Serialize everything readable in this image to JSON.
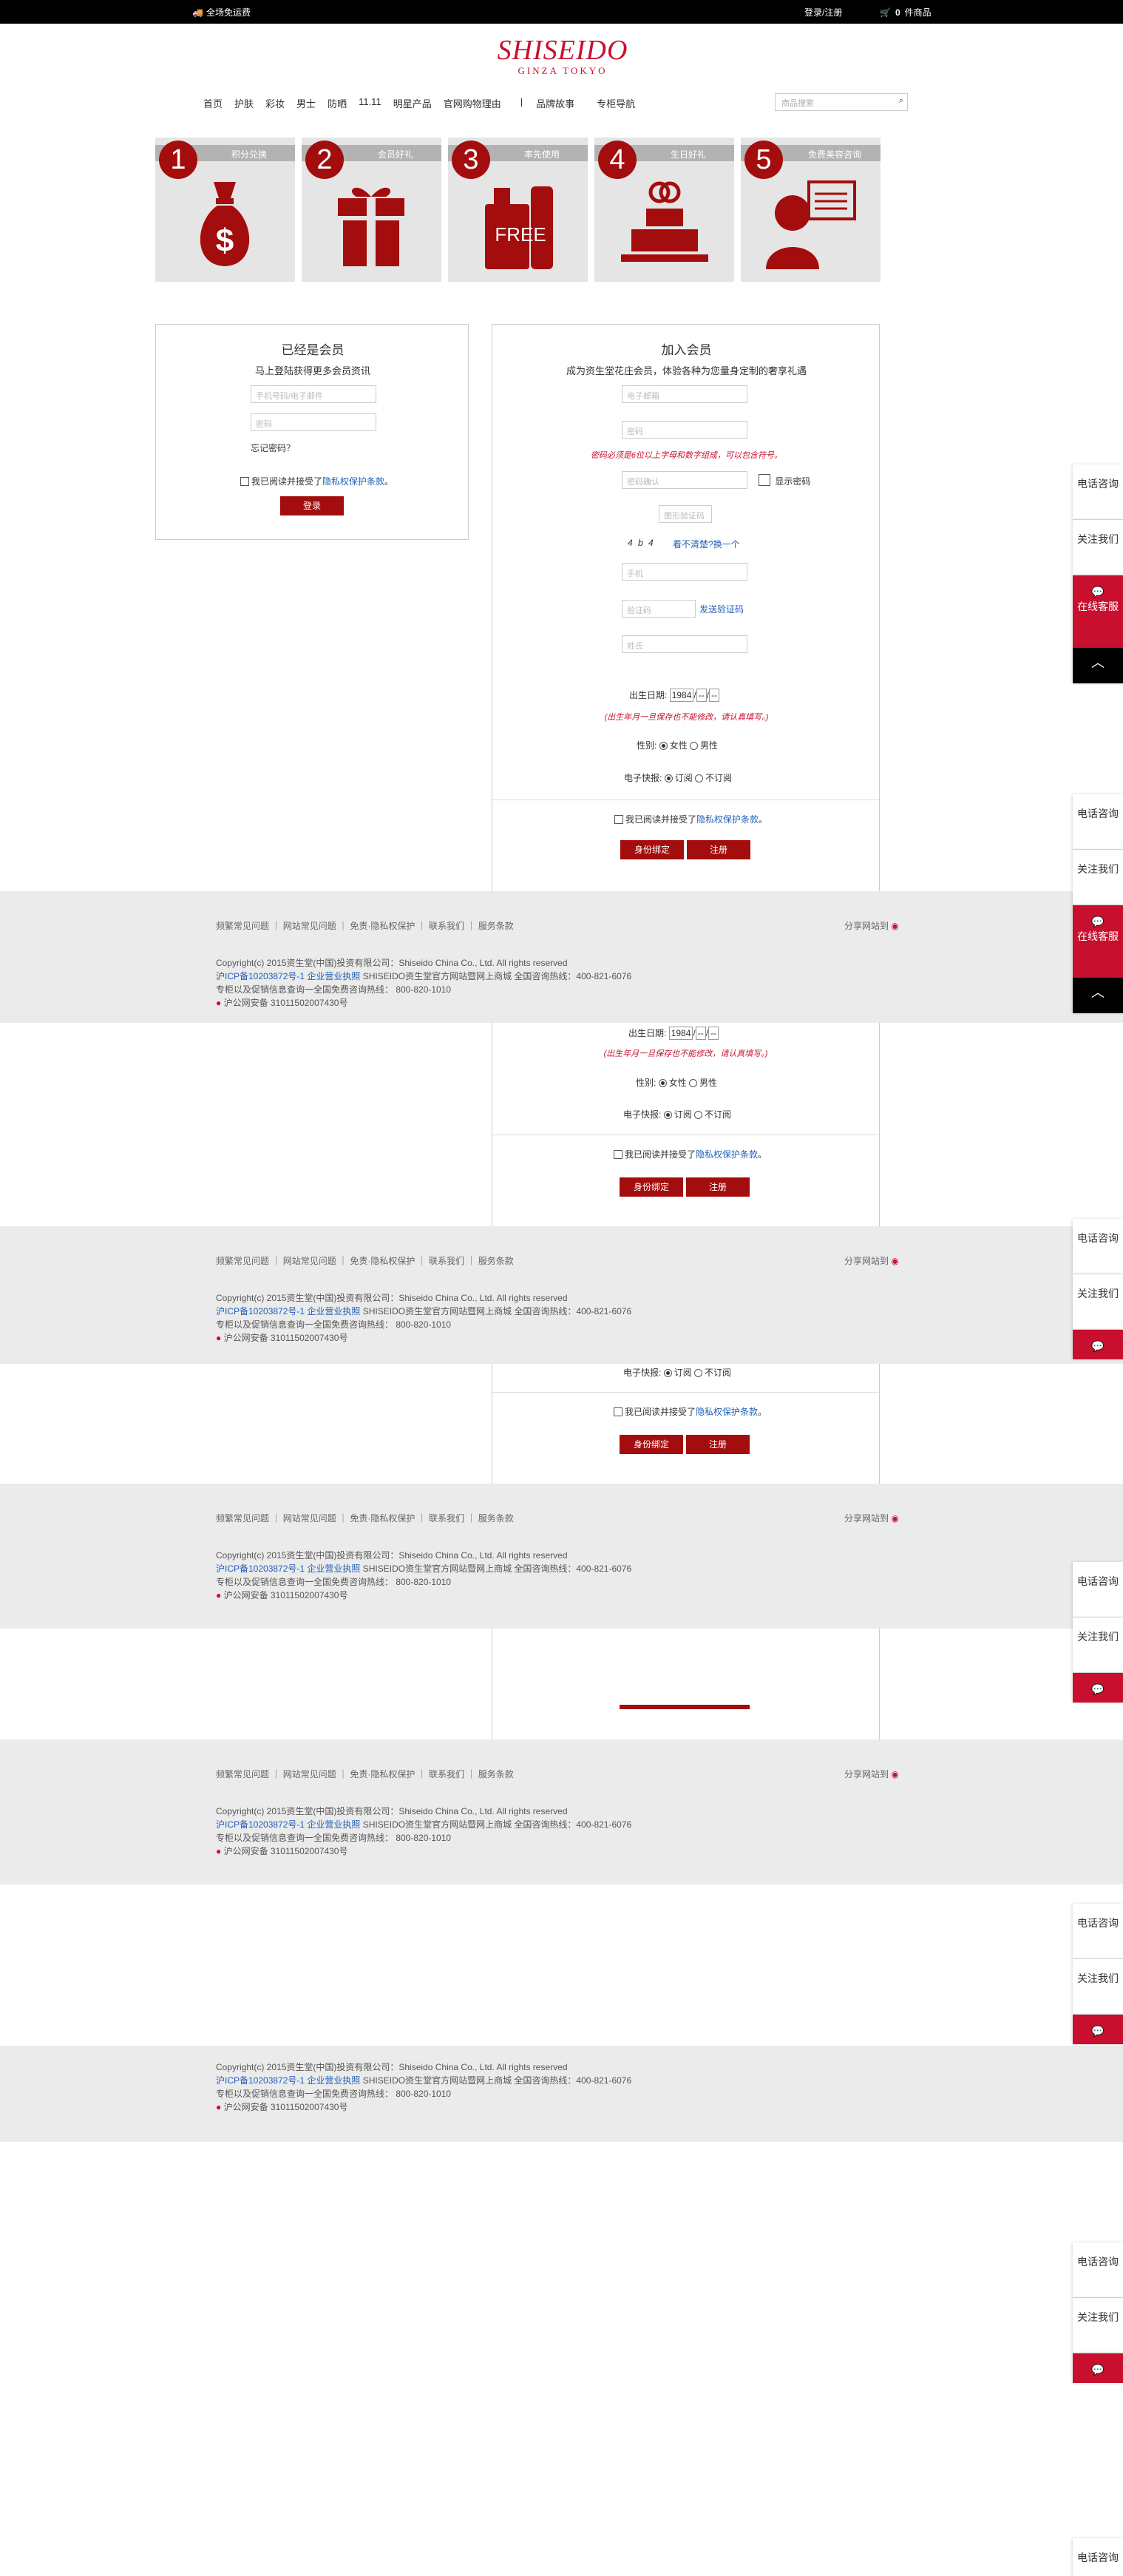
{
  "topbar": {
    "free_shipping": "全场免运费",
    "login": "登录/注册",
    "cart_count": "0",
    "cart_suffix": "件商品"
  },
  "logo": {
    "brand": "SHISEIDO",
    "sub": "GINZA TOKYO"
  },
  "nav": {
    "items": [
      "首页",
      "护肤",
      "彩妆",
      "男士",
      "防晒",
      "11.11",
      "明星产品",
      "官网购物理由",
      "品牌故事",
      "专柜导航"
    ]
  },
  "search": {
    "placeholder": "商品搜索"
  },
  "benefits": [
    {
      "n": "1",
      "label": "积分兑换",
      "icon": "money-bag-icon"
    },
    {
      "n": "2",
      "label": "会员好礼",
      "icon": "gift-icon"
    },
    {
      "n": "3",
      "label": "率先使用",
      "icon": "free-sample-icon",
      "badge": "FREE"
    },
    {
      "n": "4",
      "label": "生日好礼",
      "icon": "birthday-cake-icon"
    },
    {
      "n": "5",
      "label": "免费美容咨询",
      "icon": "consultant-icon"
    }
  ],
  "login_panel": {
    "title": "已经是会员",
    "subtitle": "马上登陆获得更多会员资讯",
    "user_placeholder": "手机号码/电子邮件",
    "pwd_placeholder": "密码",
    "forgot": "忘记密码？",
    "agree_prefix": "我已阅读并接受了",
    "privacy": "隐私权保护条款",
    "dot": "。",
    "button": "登录"
  },
  "register_panel": {
    "title": "加入会员",
    "subtitle": "成为资生堂花庄会员，体验各种为您量身定制的奢享礼遇",
    "email_placeholder": "电子邮箱",
    "pwd_placeholder": "密码",
    "pwd_hint": "密码必须是6位以上字母和数字组成，可以包含符号。",
    "pwd_confirm": "密码确认",
    "show_pwd": "显示密码",
    "captcha_placeholder": "图形验证码",
    "captcha_text": "4 b 4",
    "change_captcha": "看不清楚?换一个",
    "phone_placeholder": "手机",
    "sms_placeholder": "验证码",
    "send_sms": "发送验证码",
    "name_placeholder": "姓氏",
    "birth_label": "出生日期:",
    "birth_year": "1984",
    "birth_month": "--",
    "birth_day": "--",
    "birth_note": "(出生年月一旦保存也不能修改，请认真填写。)",
    "gender_label": "性别:",
    "female": "女性",
    "male": "男性",
    "news_label": "电子快报:",
    "subscribe": "订阅",
    "unsubscribe": "不订阅",
    "agree_prefix": "我已阅读并接受了",
    "privacy": "隐私权保护条款",
    "dot": "。",
    "btn_id": "身份绑定",
    "btn_register": "注册"
  },
  "footer": {
    "links": [
      "频繁常见问题",
      "网站常见问题",
      "免责·隐私权保护",
      "联系我们",
      "服务条款"
    ],
    "share": "分享网站到",
    "copyright": "Copyright(c) 2015资生堂(中国)投资有限公司：Shiseido China Co., Ltd. All rights reserved",
    "icp": "沪ICP备10203872号-1 企业营业执照",
    "icp_rest": " SHISEIDO资生堂官方网站暨网上商城 全国咨询热线：400-821-6076",
    "counter": "专柜以及促销信息查询一全国免费咨询热线：  800-820-1010",
    "police": "沪公网安备 31011502007430号"
  },
  "side": {
    "phone": "电话咨询",
    "follow": "关注我们",
    "online": "在线客服",
    "top": "︿"
  }
}
